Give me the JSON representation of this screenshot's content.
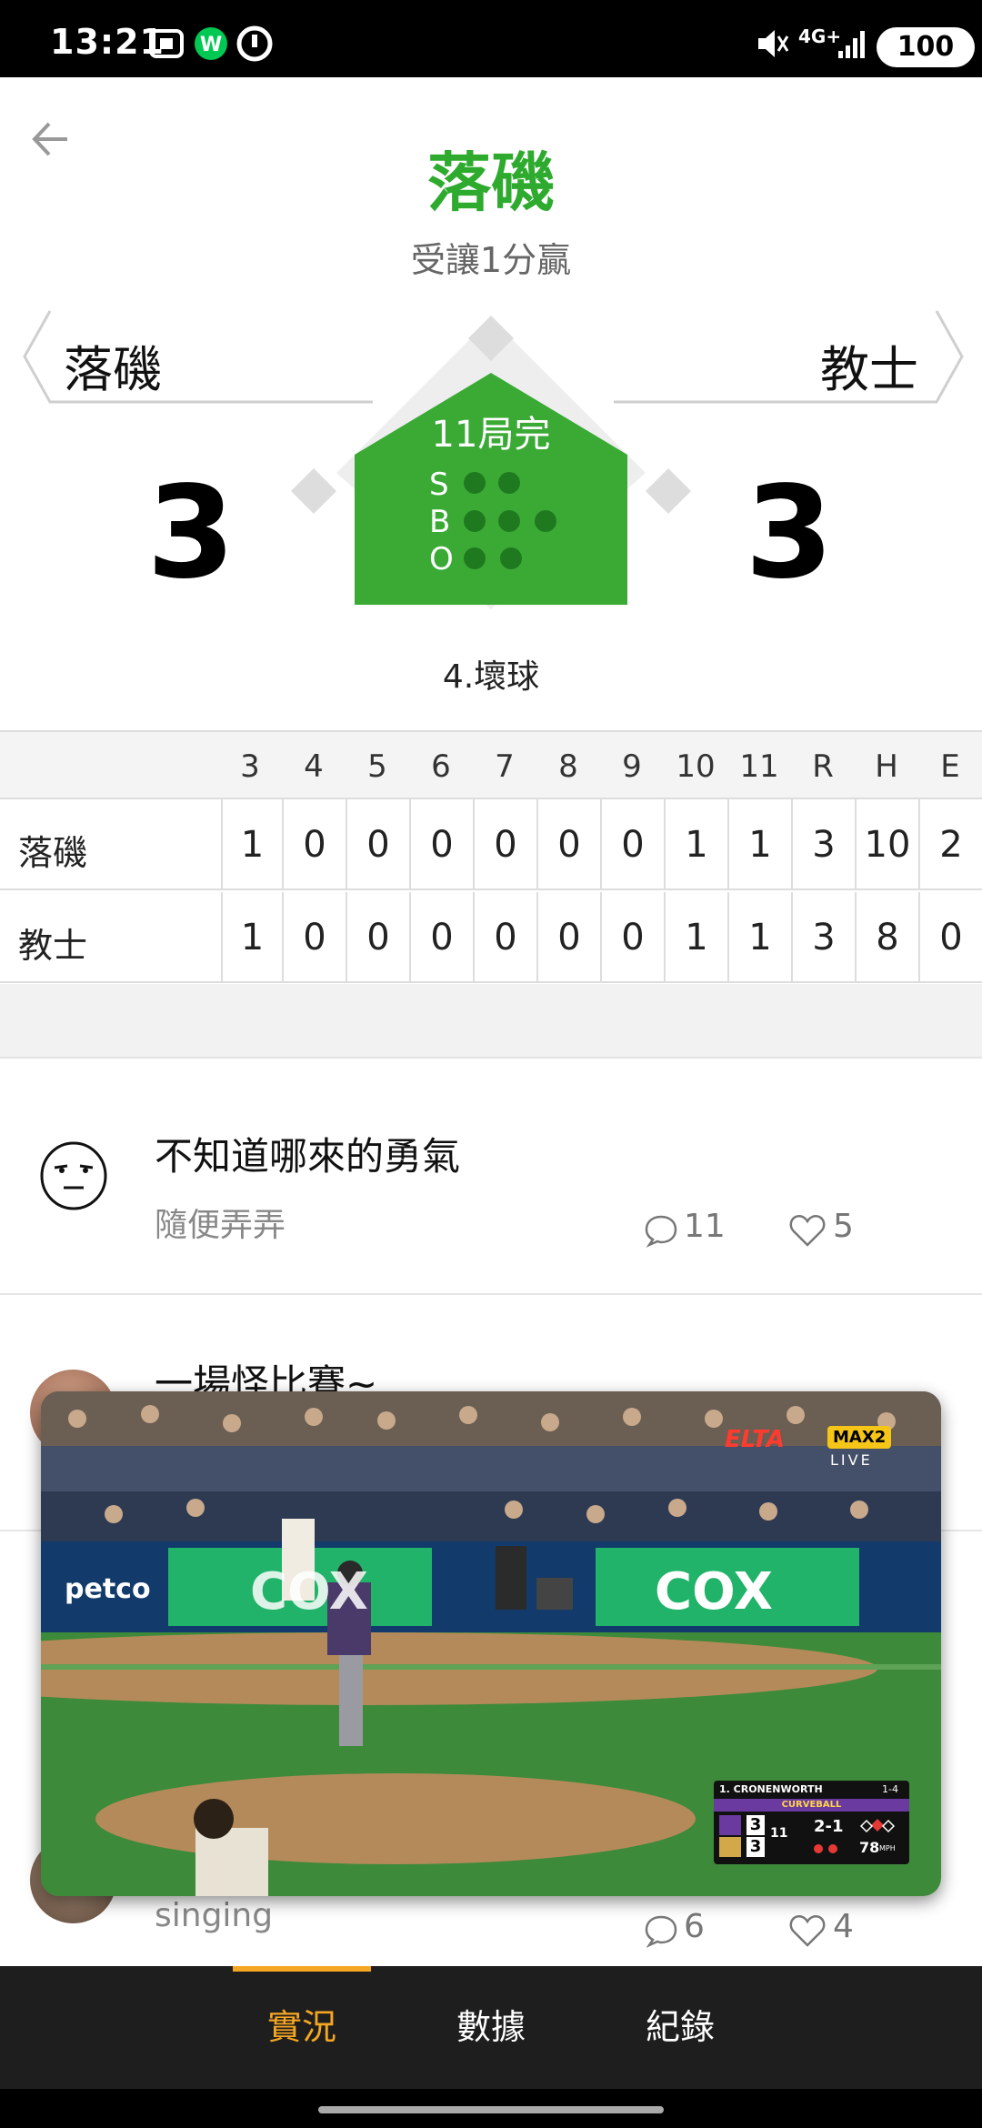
{
  "status_bar": {
    "time": "13:21",
    "network": "4G+",
    "battery": "100"
  },
  "header": {
    "title": "落磯",
    "subtitle": "受讓1分贏"
  },
  "scoreboard": {
    "away_team": "落磯",
    "home_team": "教士",
    "away_score": "3",
    "home_score": "3",
    "inning_status": "11局完",
    "count_labels": {
      "s": "S",
      "b": "B",
      "o": "O"
    },
    "last_play": "4.壞球"
  },
  "linescore": {
    "headers": [
      "3",
      "4",
      "5",
      "6",
      "7",
      "8",
      "9",
      "10",
      "11",
      "R",
      "H",
      "E"
    ],
    "rows": [
      {
        "team": "落磯",
        "values": [
          "1",
          "0",
          "0",
          "0",
          "0",
          "0",
          "0",
          "1",
          "1",
          "3",
          "10",
          "2"
        ]
      },
      {
        "team": "教士",
        "values": [
          "1",
          "0",
          "0",
          "0",
          "0",
          "0",
          "0",
          "1",
          "1",
          "3",
          "8",
          "0"
        ]
      }
    ]
  },
  "posts": [
    {
      "title": "不知道哪來的勇氣",
      "subtitle": "隨便弄弄",
      "comments": "11",
      "likes": "5"
    },
    {
      "title": "一場怪比賽~",
      "subtitle": "",
      "comments": "",
      "likes": ""
    },
    {
      "title": "",
      "subtitle": "singing",
      "comments": "6",
      "likes": "4"
    }
  ],
  "video": {
    "ad_left": "COX",
    "ad_right": "COX",
    "brand_left": "petco",
    "broadcaster": "ELTA",
    "channel": "MAX2",
    "live": "LIVE",
    "scorebug": {
      "batter": "1. CRONENWORTH",
      "batter_stat": "1-4",
      "pitch_type": "CURVEBALL",
      "away_runs": "3",
      "home_runs": "3",
      "inning": "11",
      "count": "2-1",
      "speed": "78",
      "speed_unit": "MPH"
    }
  },
  "bottom_nav": {
    "tabs": [
      "實況",
      "數據",
      "紀錄"
    ],
    "active": "實況"
  },
  "colors": {
    "accent_green": "#2eab2e",
    "accent_orange": "#f5a623",
    "nav_bg": "#1e1e1e"
  }
}
